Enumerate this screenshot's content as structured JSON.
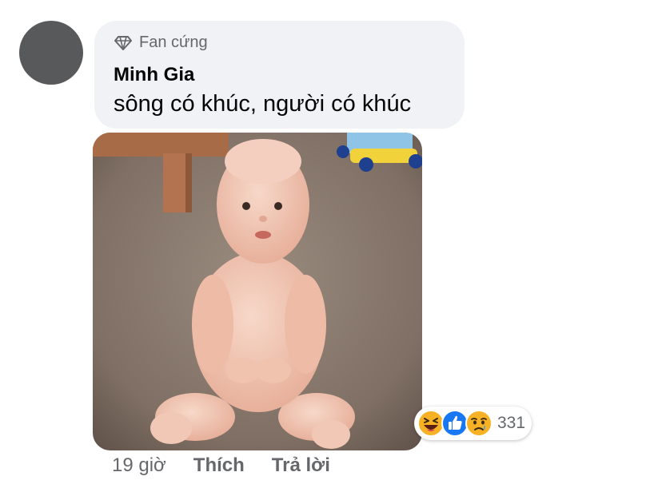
{
  "comment": {
    "avatar_color": "#58595b",
    "badge": {
      "icon": "diamond-icon",
      "label": "Fan cứng"
    },
    "author": "Minh Gia",
    "text": "sông có khúc, người có khúc",
    "photo": {
      "icon": "photo-image"
    }
  },
  "reactions": {
    "icons": [
      "haha-emoji-icon",
      "like-reaction-icon",
      "sad-emoji-icon"
    ],
    "count": "331"
  },
  "meta": {
    "time": "19 giờ",
    "like_label": "Thích",
    "reply_label": "Trả lời"
  },
  "colors": {
    "bubble_bg": "#f0f2f5",
    "secondary_text": "#65676b",
    "primary_text": "#050505",
    "like_blue": "#1877f2",
    "emoji_yellow": "#f7b125"
  }
}
